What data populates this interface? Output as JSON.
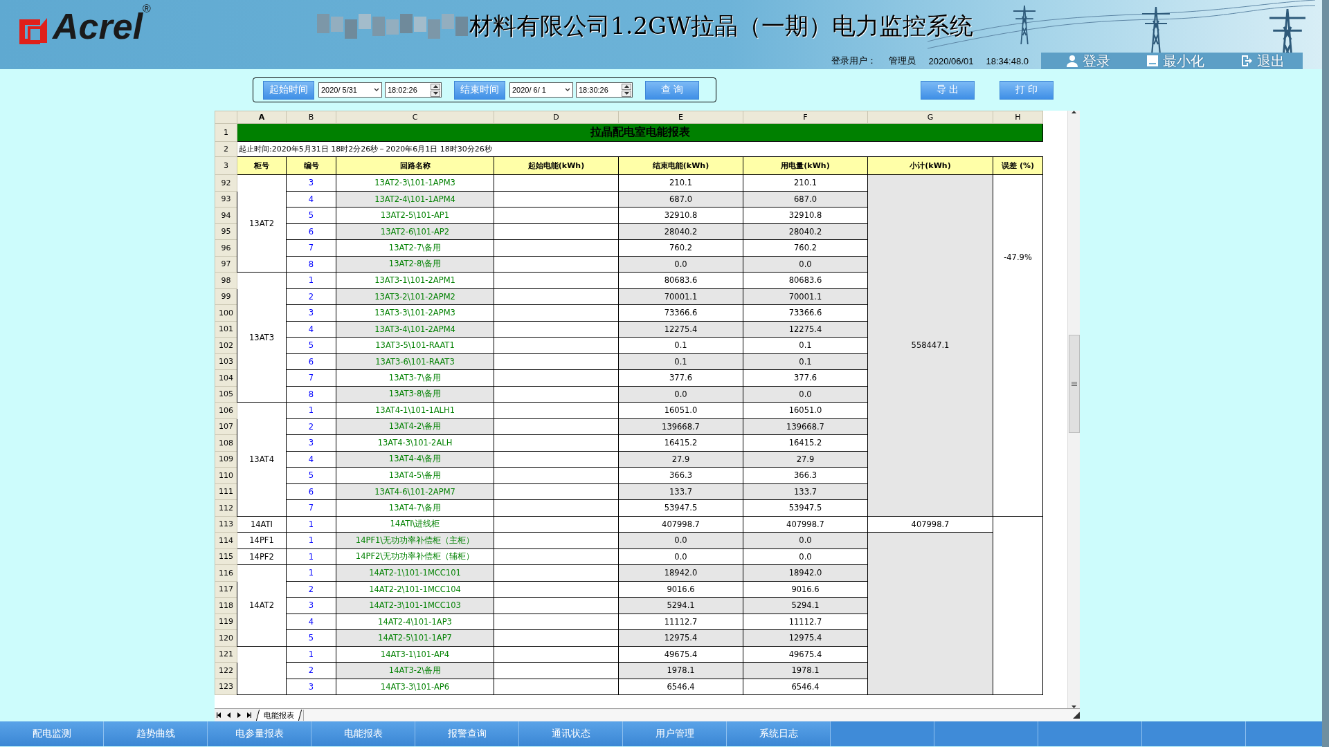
{
  "header": {
    "logo": "Acrel",
    "registered": "®",
    "title": "材料有限公司1.2GW拉晶（一期）电力监控系统",
    "user_label": "登录用户：",
    "user": "管理员",
    "date": "2020/06/01",
    "time": "18:34:48.0",
    "actions": [
      "登录",
      "最小化",
      "退出"
    ]
  },
  "query": {
    "start_button": "起始时间",
    "start_date": "2020/ 5/31",
    "start_time": "18:02:26",
    "end_button": "结束时间",
    "end_date": "2020/ 6/ 1",
    "end_time": "18:30:26",
    "search": "查 询"
  },
  "buttons": [
    "导 出",
    "打 印"
  ],
  "sheet": {
    "columns": [
      "A",
      "B",
      "C",
      "D",
      "E",
      "F",
      "G",
      "H"
    ],
    "title_row": "1",
    "title": "拉晶配电室电能报表",
    "period_row": "2",
    "period": "起止时间:2020年5月31日 18时2分26秒－2020年6月1日 18时30分26秒",
    "header_row": "3",
    "headers": [
      "柜号",
      "编号",
      "回路名称",
      "起始电能(kWh)",
      "结束电能(kWh)",
      "用电量(kWh)",
      "小计(kWh)",
      "误差 (%)"
    ],
    "blocks": [
      {
        "error": "-47.9%",
        "parts": [
          {
            "subtotal": "558447.1",
            "shaded": true,
            "groups": [
              {
                "cabinet": "13AT2",
                "rows": [
                  {
                    "row": "92",
                    "no": "3",
                    "circuit": "13AT2-3\\101-1APM3",
                    "end": "210.1",
                    "usage": "210.1",
                    "shaded": false
                  },
                  {
                    "row": "93",
                    "no": "4",
                    "circuit": "13AT2-4\\101-1APM4",
                    "end": "687.0",
                    "usage": "687.0",
                    "shaded": true
                  },
                  {
                    "row": "94",
                    "no": "5",
                    "circuit": "13AT2-5\\101-AP1",
                    "end": "32910.8",
                    "usage": "32910.8",
                    "shaded": false
                  },
                  {
                    "row": "95",
                    "no": "6",
                    "circuit": "13AT2-6\\101-AP2",
                    "end": "28040.2",
                    "usage": "28040.2",
                    "shaded": true
                  },
                  {
                    "row": "96",
                    "no": "7",
                    "circuit": "13AT2-7\\备用",
                    "end": "760.2",
                    "usage": "760.2",
                    "shaded": false
                  },
                  {
                    "row": "97",
                    "no": "8",
                    "circuit": "13AT2-8\\备用",
                    "end": "0.0",
                    "usage": "0.0",
                    "shaded": true
                  }
                ]
              },
              {
                "cabinet": "13AT3",
                "rows": [
                  {
                    "row": "98",
                    "no": "1",
                    "circuit": "13AT3-1\\101-2APM1",
                    "end": "80683.6",
                    "usage": "80683.6",
                    "shaded": false
                  },
                  {
                    "row": "99",
                    "no": "2",
                    "circuit": "13AT3-2\\101-2APM2",
                    "end": "70001.1",
                    "usage": "70001.1",
                    "shaded": true
                  },
                  {
                    "row": "100",
                    "no": "3",
                    "circuit": "13AT3-3\\101-2APM3",
                    "end": "73366.6",
                    "usage": "73366.6",
                    "shaded": false
                  },
                  {
                    "row": "101",
                    "no": "4",
                    "circuit": "13AT3-4\\101-2APM4",
                    "end": "12275.4",
                    "usage": "12275.4",
                    "shaded": true
                  },
                  {
                    "row": "102",
                    "no": "5",
                    "circuit": "13AT3-5\\101-RAAT1",
                    "end": "0.1",
                    "usage": "0.1",
                    "shaded": false
                  },
                  {
                    "row": "103",
                    "no": "6",
                    "circuit": "13AT3-6\\101-RAAT3",
                    "end": "0.1",
                    "usage": "0.1",
                    "shaded": true
                  },
                  {
                    "row": "104",
                    "no": "7",
                    "circuit": "13AT3-7\\备用",
                    "end": "377.6",
                    "usage": "377.6",
                    "shaded": false
                  },
                  {
                    "row": "105",
                    "no": "8",
                    "circuit": "13AT3-8\\备用",
                    "end": "0.0",
                    "usage": "0.0",
                    "shaded": true
                  }
                ]
              },
              {
                "cabinet": "13AT4",
                "rows": [
                  {
                    "row": "106",
                    "no": "1",
                    "circuit": "13AT4-1\\101-1ALH1",
                    "end": "16051.0",
                    "usage": "16051.0",
                    "shaded": false
                  },
                  {
                    "row": "107",
                    "no": "2",
                    "circuit": "13AT4-2\\备用",
                    "end": "139668.7",
                    "usage": "139668.7",
                    "shaded": true
                  },
                  {
                    "row": "108",
                    "no": "3",
                    "circuit": "13AT4-3\\101-2ALH",
                    "end": "16415.2",
                    "usage": "16415.2",
                    "shaded": false
                  },
                  {
                    "row": "109",
                    "no": "4",
                    "circuit": "13AT4-4\\备用",
                    "end": "27.9",
                    "usage": "27.9",
                    "shaded": true
                  },
                  {
                    "row": "110",
                    "no": "5",
                    "circuit": "13AT4-5\\备用",
                    "end": "366.3",
                    "usage": "366.3",
                    "shaded": false
                  },
                  {
                    "row": "111",
                    "no": "6",
                    "circuit": "13AT4-6\\101-2APM7",
                    "end": "133.7",
                    "usage": "133.7",
                    "shaded": true
                  },
                  {
                    "row": "112",
                    "no": "7",
                    "circuit": "13AT4-7\\备用",
                    "end": "53947.5",
                    "usage": "53947.5",
                    "shaded": false
                  }
                ]
              }
            ]
          }
        ]
      },
      {
        "parts": [
          {
            "subtotal": "407998.7",
            "shaded": false,
            "groups": [
              {
                "cabinet": "14ATI",
                "rows": [
                  {
                    "row": "113",
                    "no": "1",
                    "circuit": "14ATI\\进线柜",
                    "end": "407998.7",
                    "usage": "407998.7",
                    "shaded": false
                  }
                ]
              }
            ]
          },
          {
            "shaded": true,
            "groups": [
              {
                "cabinet": "14PF1",
                "rows": [
                  {
                    "row": "114",
                    "no": "1",
                    "circuit": "14PF1\\无功功率补偿柜（主柜）",
                    "end": "0.0",
                    "usage": "0.0",
                    "shaded": true
                  }
                ]
              },
              {
                "cabinet": "14PF2",
                "rows": [
                  {
                    "row": "115",
                    "no": "1",
                    "circuit": "14PF2\\无功功率补偿柜（辅柜）",
                    "end": "0.0",
                    "usage": "0.0",
                    "shaded": false
                  }
                ]
              },
              {
                "cabinet": "14AT2",
                "rows": [
                  {
                    "row": "116",
                    "no": "1",
                    "circuit": "14AT2-1\\101-1MCC101",
                    "end": "18942.0",
                    "usage": "18942.0",
                    "shaded": true
                  },
                  {
                    "row": "117",
                    "no": "2",
                    "circuit": "14AT2-2\\101-1MCC104",
                    "end": "9016.6",
                    "usage": "9016.6",
                    "shaded": false
                  },
                  {
                    "row": "118",
                    "no": "3",
                    "circuit": "14AT2-3\\101-1MCC103",
                    "end": "5294.1",
                    "usage": "5294.1",
                    "shaded": true
                  },
                  {
                    "row": "119",
                    "no": "4",
                    "circuit": "14AT2-4\\101-1AP3",
                    "end": "11112.7",
                    "usage": "11112.7",
                    "shaded": false
                  },
                  {
                    "row": "120",
                    "no": "5",
                    "circuit": "14AT2-5\\101-1AP7",
                    "end": "12975.4",
                    "usage": "12975.4",
                    "shaded": true
                  }
                ]
              },
              {
                "rows": [
                  {
                    "row": "121",
                    "no": "1",
                    "circuit": "14AT3-1\\101-AP4",
                    "end": "49675.4",
                    "usage": "49675.4",
                    "shaded": false
                  },
                  {
                    "row": "122",
                    "no": "2",
                    "circuit": "14AT3-2\\备用",
                    "end": "1978.1",
                    "usage": "1978.1",
                    "shaded": true
                  },
                  {
                    "row": "123",
                    "no": "3",
                    "circuit": "14AT3-3\\101-AP6",
                    "end": "6546.4",
                    "usage": "6546.4",
                    "shaded": false
                  }
                ]
              }
            ]
          }
        ]
      }
    ],
    "tabs": [
      {
        "label": "电能报表",
        "selected": true
      }
    ]
  },
  "nav": [
    "配电监测",
    "趋势曲线",
    "电参量报表",
    "电能报表",
    "报警查询",
    "通讯状态",
    "用户管理",
    "系统日志"
  ]
}
